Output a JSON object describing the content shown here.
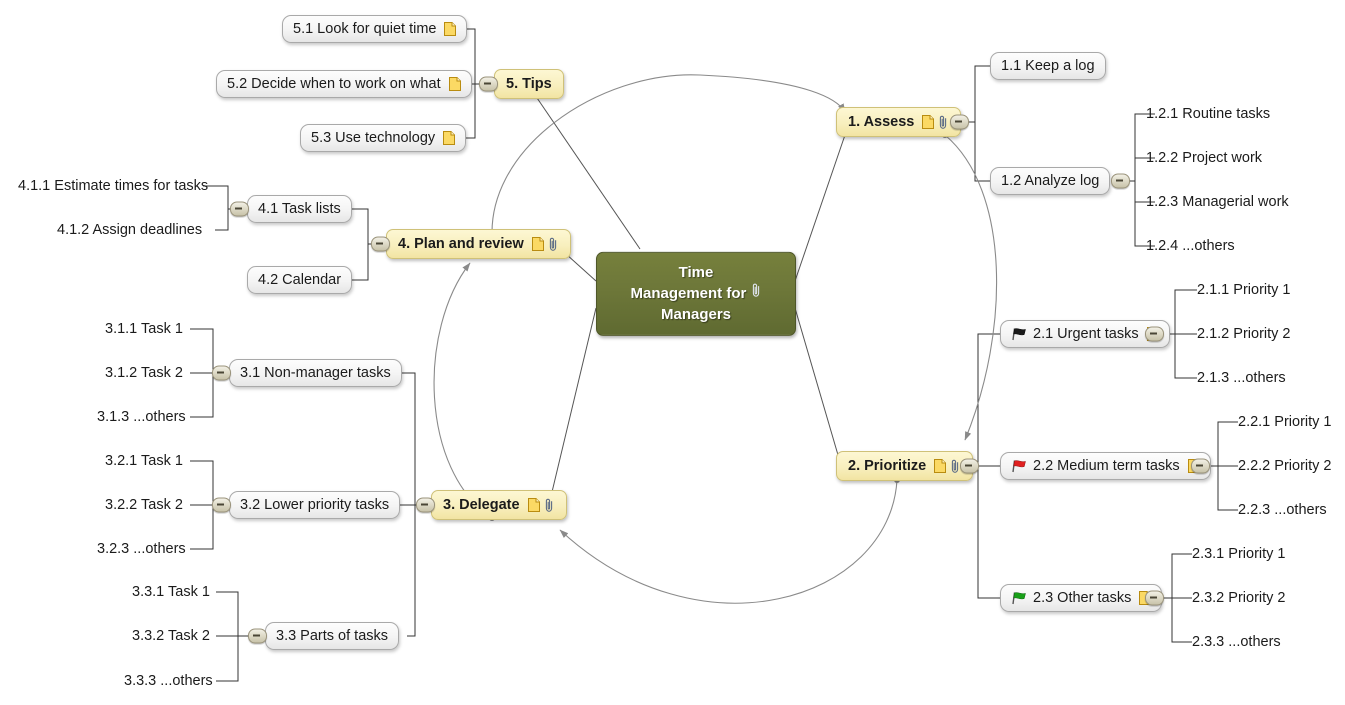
{
  "document": {
    "type": "mind-map",
    "title": "Time Management for Managers"
  },
  "colors": {
    "root_fill": "#6d7739",
    "root_text": "#ffffff",
    "main_fill": "#f8efbe",
    "main_border": "#cfc178",
    "sub_fill": "#f4f4f4",
    "sub_border": "#a9a9a9",
    "link": "#808080",
    "text": "#1b1b1b",
    "flag_urgent": "#1a1a1a",
    "flag_medium": "#e02020",
    "flag_other": "#18a018"
  },
  "root": {
    "label": "Time Management for Managers",
    "line1": "Time",
    "line2": "Management for",
    "line3": "Managers",
    "icons": [
      "attachment-icon"
    ]
  },
  "nodes": [
    {
      "id": "n1",
      "label": "1.  Assess",
      "level": "main",
      "icons": [
        "note-icon",
        "attachment-icon"
      ],
      "toggle": "right"
    },
    {
      "id": "n1_1",
      "label": "1.1  Keep a log",
      "level": "sub",
      "icons": []
    },
    {
      "id": "n1_2",
      "label": "1.2  Analyze log",
      "level": "sub",
      "icons": [],
      "toggle": "right"
    },
    {
      "id": "n1_2_1",
      "label": "1.2.1  Routine tasks",
      "level": "leaf",
      "icons": []
    },
    {
      "id": "n1_2_2",
      "label": "1.2.2  Project work",
      "level": "leaf",
      "icons": []
    },
    {
      "id": "n1_2_3",
      "label": "1.2.3  Managerial work",
      "level": "leaf",
      "icons": []
    },
    {
      "id": "n1_2_4",
      "label": "1.2.4  ...others",
      "level": "leaf",
      "icons": []
    },
    {
      "id": "n2",
      "label": "2.  Prioritize",
      "level": "main",
      "icons": [
        "note-icon",
        "attachment-icon"
      ],
      "toggle": "right"
    },
    {
      "id": "n2_1",
      "label": "2.1  Urgent tasks",
      "level": "sub",
      "icons": [
        "note-icon"
      ],
      "flag": "black",
      "toggle": "right"
    },
    {
      "id": "n2_1_1",
      "label": "2.1.1  Priority 1",
      "level": "leaf",
      "icons": []
    },
    {
      "id": "n2_1_2",
      "label": "2.1.2  Priority 2",
      "level": "leaf",
      "icons": []
    },
    {
      "id": "n2_1_3",
      "label": "2.1.3  ...others",
      "level": "leaf",
      "icons": []
    },
    {
      "id": "n2_2",
      "label": "2.2  Medium term tasks",
      "level": "sub",
      "icons": [
        "note-icon"
      ],
      "flag": "red",
      "toggle": "right"
    },
    {
      "id": "n2_2_1",
      "label": "2.2.1  Priority 1",
      "level": "leaf",
      "icons": []
    },
    {
      "id": "n2_2_2",
      "label": "2.2.2  Priority 2",
      "level": "leaf",
      "icons": []
    },
    {
      "id": "n2_2_3",
      "label": "2.2.3  ...others",
      "level": "leaf",
      "icons": []
    },
    {
      "id": "n2_3",
      "label": "2.3  Other tasks",
      "level": "sub",
      "icons": [
        "note-icon"
      ],
      "flag": "green",
      "toggle": "right"
    },
    {
      "id": "n2_3_1",
      "label": "2.3.1  Priority 1",
      "level": "leaf",
      "icons": []
    },
    {
      "id": "n2_3_2",
      "label": "2.3.2  Priority 2",
      "level": "leaf",
      "icons": []
    },
    {
      "id": "n2_3_3",
      "label": "2.3.3  ...others",
      "level": "leaf",
      "icons": []
    },
    {
      "id": "n3",
      "label": "3.  Delegate",
      "level": "main",
      "icons": [
        "note-icon",
        "attachment-icon"
      ],
      "toggle": "left"
    },
    {
      "id": "n3_1",
      "label": "3.1  Non-manager tasks",
      "level": "sub",
      "icons": [],
      "toggle": "left"
    },
    {
      "id": "n3_1_1",
      "label": "3.1.1  Task 1",
      "level": "leaf",
      "icons": []
    },
    {
      "id": "n3_1_2",
      "label": "3.1.2  Task 2",
      "level": "leaf",
      "icons": []
    },
    {
      "id": "n3_1_3",
      "label": "3.1.3  ...others",
      "level": "leaf",
      "icons": []
    },
    {
      "id": "n3_2",
      "label": "3.2  Lower priority tasks",
      "level": "sub",
      "icons": [],
      "toggle": "left"
    },
    {
      "id": "n3_2_1",
      "label": "3.2.1  Task 1",
      "level": "leaf",
      "icons": []
    },
    {
      "id": "n3_2_2",
      "label": "3.2.2  Task 2",
      "level": "leaf",
      "icons": []
    },
    {
      "id": "n3_2_3",
      "label": "3.2.3  ...others",
      "level": "leaf",
      "icons": []
    },
    {
      "id": "n3_3",
      "label": "3.3  Parts of tasks",
      "level": "sub",
      "icons": [],
      "toggle": "left"
    },
    {
      "id": "n3_3_1",
      "label": "3.3.1  Task 1",
      "level": "leaf",
      "icons": []
    },
    {
      "id": "n3_3_2",
      "label": "3.3.2  Task 2",
      "level": "leaf",
      "icons": []
    },
    {
      "id": "n3_3_3",
      "label": "3.3.3  ...others",
      "level": "leaf",
      "icons": []
    },
    {
      "id": "n4",
      "label": "4.  Plan and review",
      "level": "main",
      "icons": [
        "note-icon",
        "attachment-icon"
      ],
      "toggle": "left"
    },
    {
      "id": "n4_1",
      "label": "4.1  Task lists",
      "level": "sub",
      "icons": [],
      "toggle": "left"
    },
    {
      "id": "n4_1_1",
      "label": "4.1.1  Estimate times for tasks",
      "level": "leaf",
      "icons": []
    },
    {
      "id": "n4_1_2",
      "label": "4.1.2  Assign deadlines",
      "level": "leaf",
      "icons": []
    },
    {
      "id": "n4_2",
      "label": "4.2  Calendar",
      "level": "sub",
      "icons": []
    },
    {
      "id": "n5",
      "label": "5.  Tips",
      "level": "main",
      "icons": [],
      "toggle": "left"
    },
    {
      "id": "n5_1",
      "label": "5.1  Look for quiet time",
      "level": "sub",
      "icons": [
        "note-icon"
      ]
    },
    {
      "id": "n5_2",
      "label": "5.2  Decide when to work on what",
      "level": "sub",
      "icons": [
        "note-icon"
      ]
    },
    {
      "id": "n5_3",
      "label": "5.3  Use technology",
      "level": "sub",
      "icons": [
        "note-icon"
      ]
    }
  ],
  "relationship_arrows": [
    {
      "from": "4. Plan and review",
      "to": "1. Assess"
    },
    {
      "from": "1. Assess",
      "to": "2. Prioritize"
    },
    {
      "from": "2. Prioritize",
      "to": "3. Delegate"
    },
    {
      "from": "3. Delegate",
      "to": "4. Plan and review"
    }
  ]
}
